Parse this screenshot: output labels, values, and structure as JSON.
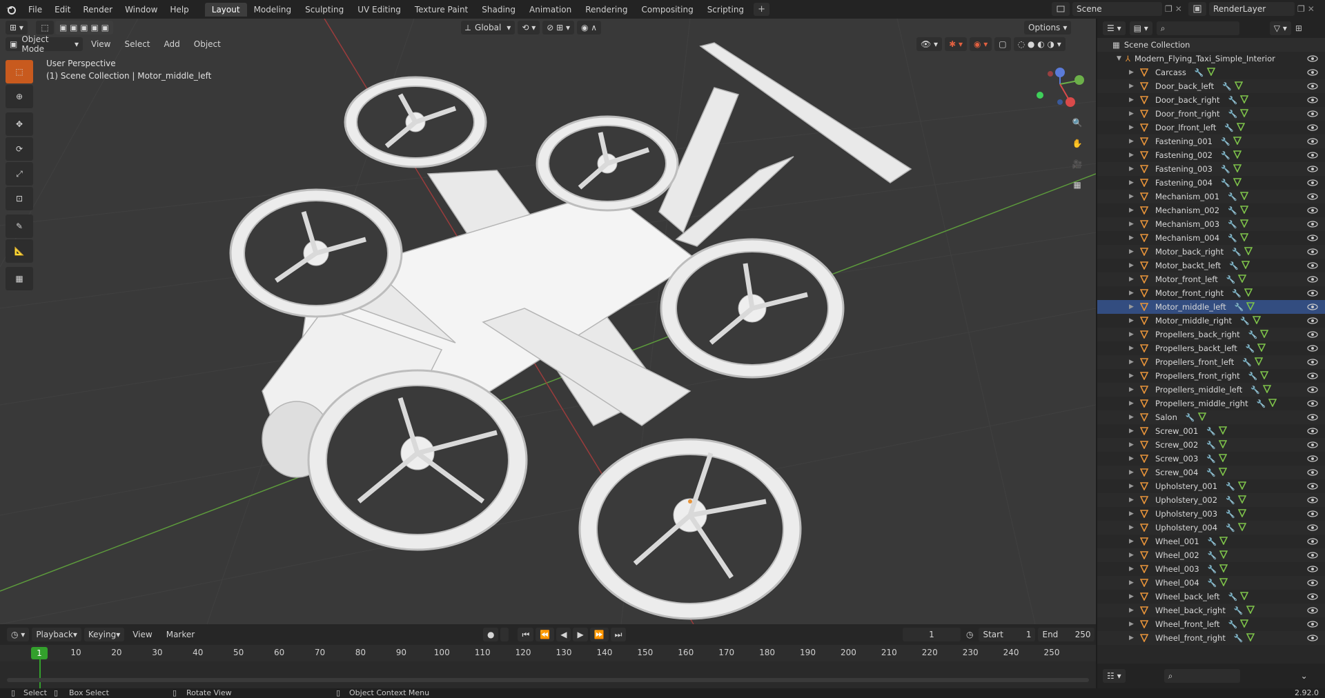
{
  "app": {
    "menus": [
      "File",
      "Edit",
      "Render",
      "Window",
      "Help"
    ],
    "workspaces": [
      "Layout",
      "Modeling",
      "Sculpting",
      "UV Editing",
      "Texture Paint",
      "Shading",
      "Animation",
      "Rendering",
      "Compositing",
      "Scripting"
    ],
    "active_workspace": "Layout",
    "add_tab": "+",
    "scene": "Scene",
    "view_layer": "RenderLayer"
  },
  "viewport": {
    "mode": "Object Mode",
    "menus": [
      "View",
      "Select",
      "Add",
      "Object"
    ],
    "transform_orientation": "Global",
    "options_label": "Options",
    "overlay_title": "User Perspective",
    "overlay_sub": "(1) Scene Collection | Motor_middle_left",
    "gizmo_axes": [
      "Z",
      "Y",
      "X"
    ]
  },
  "outliner": {
    "root": "Scene Collection",
    "collection": "Modern_Flying_Taxi_Simple_Interior",
    "selected": "Motor_middle_left",
    "items": [
      "Carcass",
      "Door_back_left",
      "Door_back_right",
      "Door_front_right",
      "Door_lfront_left",
      "Fastening_001",
      "Fastening_002",
      "Fastening_003",
      "Fastening_004",
      "Mechanism_001",
      "Mechanism_002",
      "Mechanism_003",
      "Mechanism_004",
      "Motor_back_right",
      "Motor_backt_left",
      "Motor_front_left",
      "Motor_front_right",
      "Motor_middle_left",
      "Motor_middle_right",
      "Propellers_back_right",
      "Propellers_backt_left",
      "Propellers_front_left",
      "Propellers_front_right",
      "Propellers_middle_left",
      "Propellers_middle_right",
      "Salon",
      "Screw_001",
      "Screw_002",
      "Screw_003",
      "Screw_004",
      "Upholstery_001",
      "Upholstery_002",
      "Upholstery_003",
      "Upholstery_004",
      "Wheel_001",
      "Wheel_002",
      "Wheel_003",
      "Wheel_004",
      "Wheel_back_left",
      "Wheel_back_right",
      "Wheel_front_left",
      "Wheel_front_right"
    ]
  },
  "timeline": {
    "menus": [
      "Playback",
      "Keying",
      "View",
      "Marker"
    ],
    "current_frame": "1",
    "start_label": "Start",
    "start": "1",
    "end_label": "End",
    "end": "250",
    "ticks": [
      "10",
      "20",
      "30",
      "40",
      "50",
      "60",
      "70",
      "80",
      "90",
      "100",
      "110",
      "120",
      "130",
      "140",
      "150",
      "160",
      "170",
      "180",
      "190",
      "200",
      "210",
      "220",
      "230",
      "240",
      "250"
    ]
  },
  "status": {
    "select": "Select",
    "box_select": "Box Select",
    "rotate": "Rotate View",
    "context": "Object Context Menu",
    "version": "2.92.0"
  }
}
